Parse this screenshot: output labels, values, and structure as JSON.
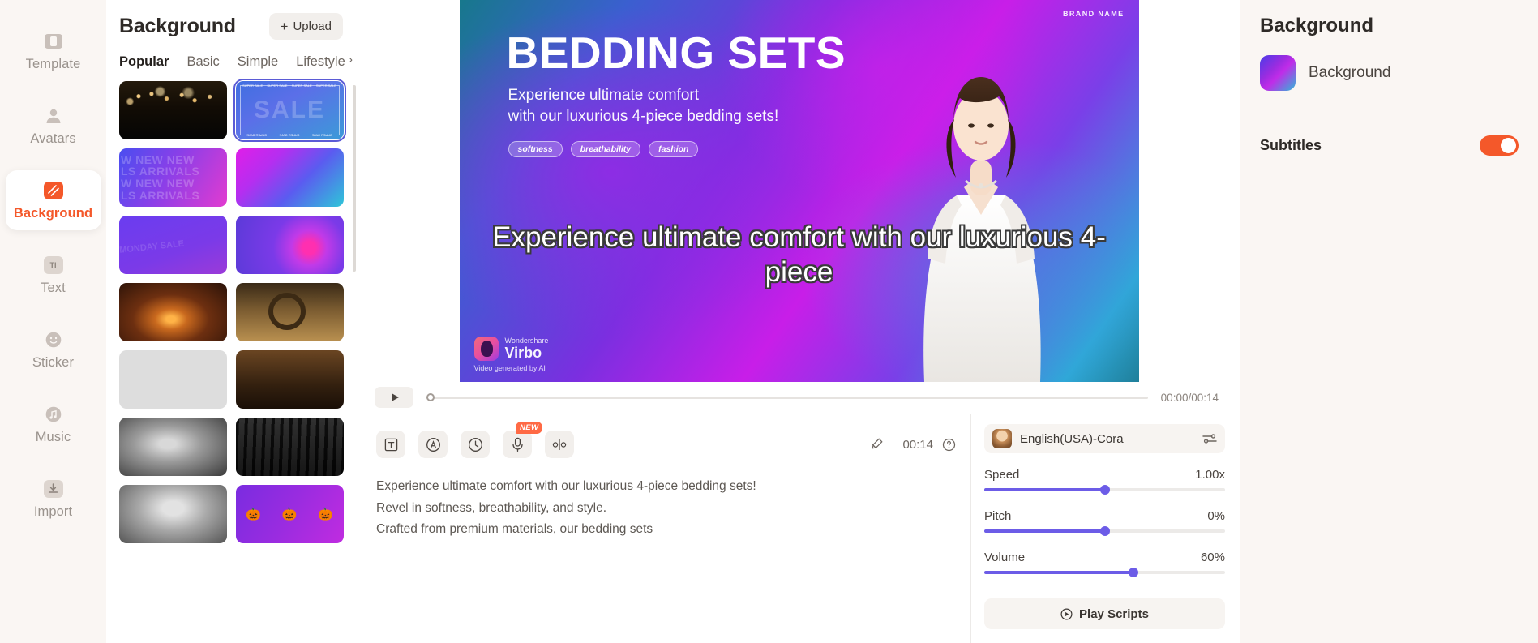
{
  "rail": {
    "items": [
      {
        "label": "Template",
        "icon": "template-icon",
        "active": false
      },
      {
        "label": "Avatars",
        "icon": "avatars-icon",
        "active": false
      },
      {
        "label": "Background",
        "icon": "background-icon",
        "active": true
      },
      {
        "label": "Text",
        "icon": "text-icon",
        "active": false
      },
      {
        "label": "Sticker",
        "icon": "sticker-icon",
        "active": false
      },
      {
        "label": "Music",
        "icon": "music-icon",
        "active": false
      },
      {
        "label": "Import",
        "icon": "import-icon",
        "active": false
      }
    ]
  },
  "library": {
    "title": "Background",
    "upload_label": "Upload",
    "upload_plus": "+",
    "tabs": [
      {
        "label": "Popular",
        "active": true
      },
      {
        "label": "Basic",
        "active": false
      },
      {
        "label": "Simple",
        "active": false
      },
      {
        "label": "Lifestyle",
        "active": false
      }
    ],
    "tabs_more_icon": "chevron-right-icon",
    "thumbnails": [
      {
        "name": "bokeh-lights",
        "selected": false
      },
      {
        "name": "super-sale-frame",
        "selected": true,
        "text": "SALE",
        "marquee": "SUPER SALE"
      },
      {
        "name": "new-arrivals",
        "selected": false,
        "text": "NEW NEW NEW\nALS ARRIVALS\nW NEW NEW\nALS ARRIVALS"
      },
      {
        "name": "magenta-cyan-gradient",
        "selected": false
      },
      {
        "name": "purple-diagonal",
        "selected": false,
        "text": "MONDAY SALE"
      },
      {
        "name": "purple-circle-gradient",
        "selected": false
      },
      {
        "name": "fireplace-room",
        "selected": false
      },
      {
        "name": "wreath-dining",
        "selected": false
      },
      {
        "name": "kitchen-table",
        "selected": false
      },
      {
        "name": "kitchen-counter",
        "selected": false
      },
      {
        "name": "gray-smoke",
        "selected": false
      },
      {
        "name": "dark-forest",
        "selected": false
      },
      {
        "name": "gray-clouds",
        "selected": false
      },
      {
        "name": "halloween-pumpkins",
        "selected": false,
        "text": "🎃   🎃   🎃"
      }
    ]
  },
  "video": {
    "brand": "BRAND NAME",
    "headline": "BEDDING SETS",
    "subhead": "Experience ultimate comfort\nwith our luxurious 4-piece bedding sets!",
    "pills": [
      "softness",
      "breathability",
      "fashion"
    ],
    "caption": "Experience ultimate comfort with our luxurious 4-piece",
    "watermark": {
      "brand_small": "Wondershare",
      "brand_big": "Virbo",
      "note": "Video generated by AI"
    }
  },
  "playbar": {
    "play_icon": "play-icon",
    "time": "00:00/00:14",
    "progress_percent": 0
  },
  "tools": {
    "buttons": [
      {
        "name": "text-style-button",
        "icon": "text-box-icon",
        "badge": ""
      },
      {
        "name": "auto-button",
        "icon": "circled-a-icon",
        "badge": ""
      },
      {
        "name": "duration-button",
        "icon": "clock-icon",
        "badge": ""
      },
      {
        "name": "voice-clone-button",
        "icon": "microphone-icon",
        "badge": "NEW"
      },
      {
        "name": "pause-split-button",
        "icon": "split-icon",
        "badge": ""
      }
    ],
    "brush_icon": "brush-icon",
    "duration": "00:14",
    "help_icon": "help-circle-icon"
  },
  "script": {
    "text": "Experience ultimate comfort with our luxurious 4-piece bedding sets!\nRevel in softness, breathability, and style.\nCrafted from premium materials, our bedding sets"
  },
  "voice": {
    "selected": "English(USA)-Cora",
    "avatar_icon": "voice-avatar",
    "settings_icon": "equalizer-icon",
    "controls": [
      {
        "label": "Speed",
        "value": "1.00x",
        "percent": 50
      },
      {
        "label": "Pitch",
        "value": "0%",
        "percent": 50
      },
      {
        "label": "Volume",
        "value": "60%",
        "percent": 62
      }
    ],
    "play_scripts_label": "Play Scripts",
    "play_scripts_icon": "play-circle-icon"
  },
  "right_panel": {
    "title": "Background",
    "item_label": "Background",
    "subtitles_label": "Subtitles",
    "subtitles_on": true
  },
  "colors": {
    "accent": "#f4582a",
    "slider": "#6c5ce7",
    "panel_bg": "#faf6f3",
    "selection": "#5b5bd6"
  }
}
